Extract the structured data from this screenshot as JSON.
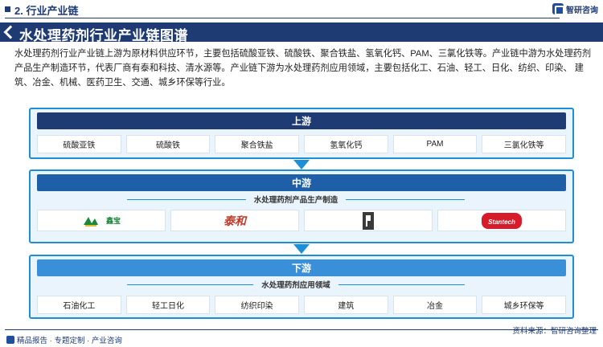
{
  "header": {
    "section": "2. 行业产业链",
    "brand": "智研咨询",
    "title": "水处理药剂行业产业链图谱"
  },
  "description": "水处理药剂行业产业链上游为原材料供应环节，主要包括硫酸亚铁、硫酸铁、聚合铁盐、氢氧化钙、PAM、三氯化铁等。产业链中游为水处理药剂产品生产制造环节，代表厂商有泰和科技、清水源等。产业链下游为水处理药剂应用领域，主要包括化工、石油、轻工、日化、纺织、印染、 建筑、冶金、机械、医药卫生、交通、城乡环保等行业。",
  "upstream": {
    "label": "上游",
    "items": [
      "硫酸亚铁",
      "硫酸铁",
      "聚合铁盐",
      "氢氧化钙",
      "PAM",
      "三氯化铁等"
    ]
  },
  "midstream": {
    "label": "中游",
    "sub": "水处理药剂产品生产制造",
    "logos": [
      {
        "icon": "company-logo-1-icon",
        "text": "鑫宝",
        "color": "#1a8a3a"
      },
      {
        "icon": "taihe-logo-icon",
        "text": "泰和",
        "color": "#c0392b"
      },
      {
        "icon": "company-logo-3-icon",
        "text": "",
        "color": "#333333"
      },
      {
        "icon": "stantech-logo-icon",
        "text": "Stantech",
        "color": "#d81b2a"
      }
    ]
  },
  "downstream": {
    "label": "下游",
    "sub": "水处理药剂应用领域",
    "items": [
      "石油化工",
      "轻工日化",
      "纺织印染",
      "建筑",
      "冶金",
      "城乡环保等"
    ]
  },
  "footer": {
    "left": "精品报告 · 专题定制 · 产业咨询",
    "right": "资料来源：智研咨询整理"
  },
  "colors": {
    "navy": "#1f3b73",
    "upstream_head": "#1f3b73",
    "midstream_head": "#1f5fa8",
    "downstream_head": "#3a8fd9",
    "frame": "#1e8fd6"
  }
}
